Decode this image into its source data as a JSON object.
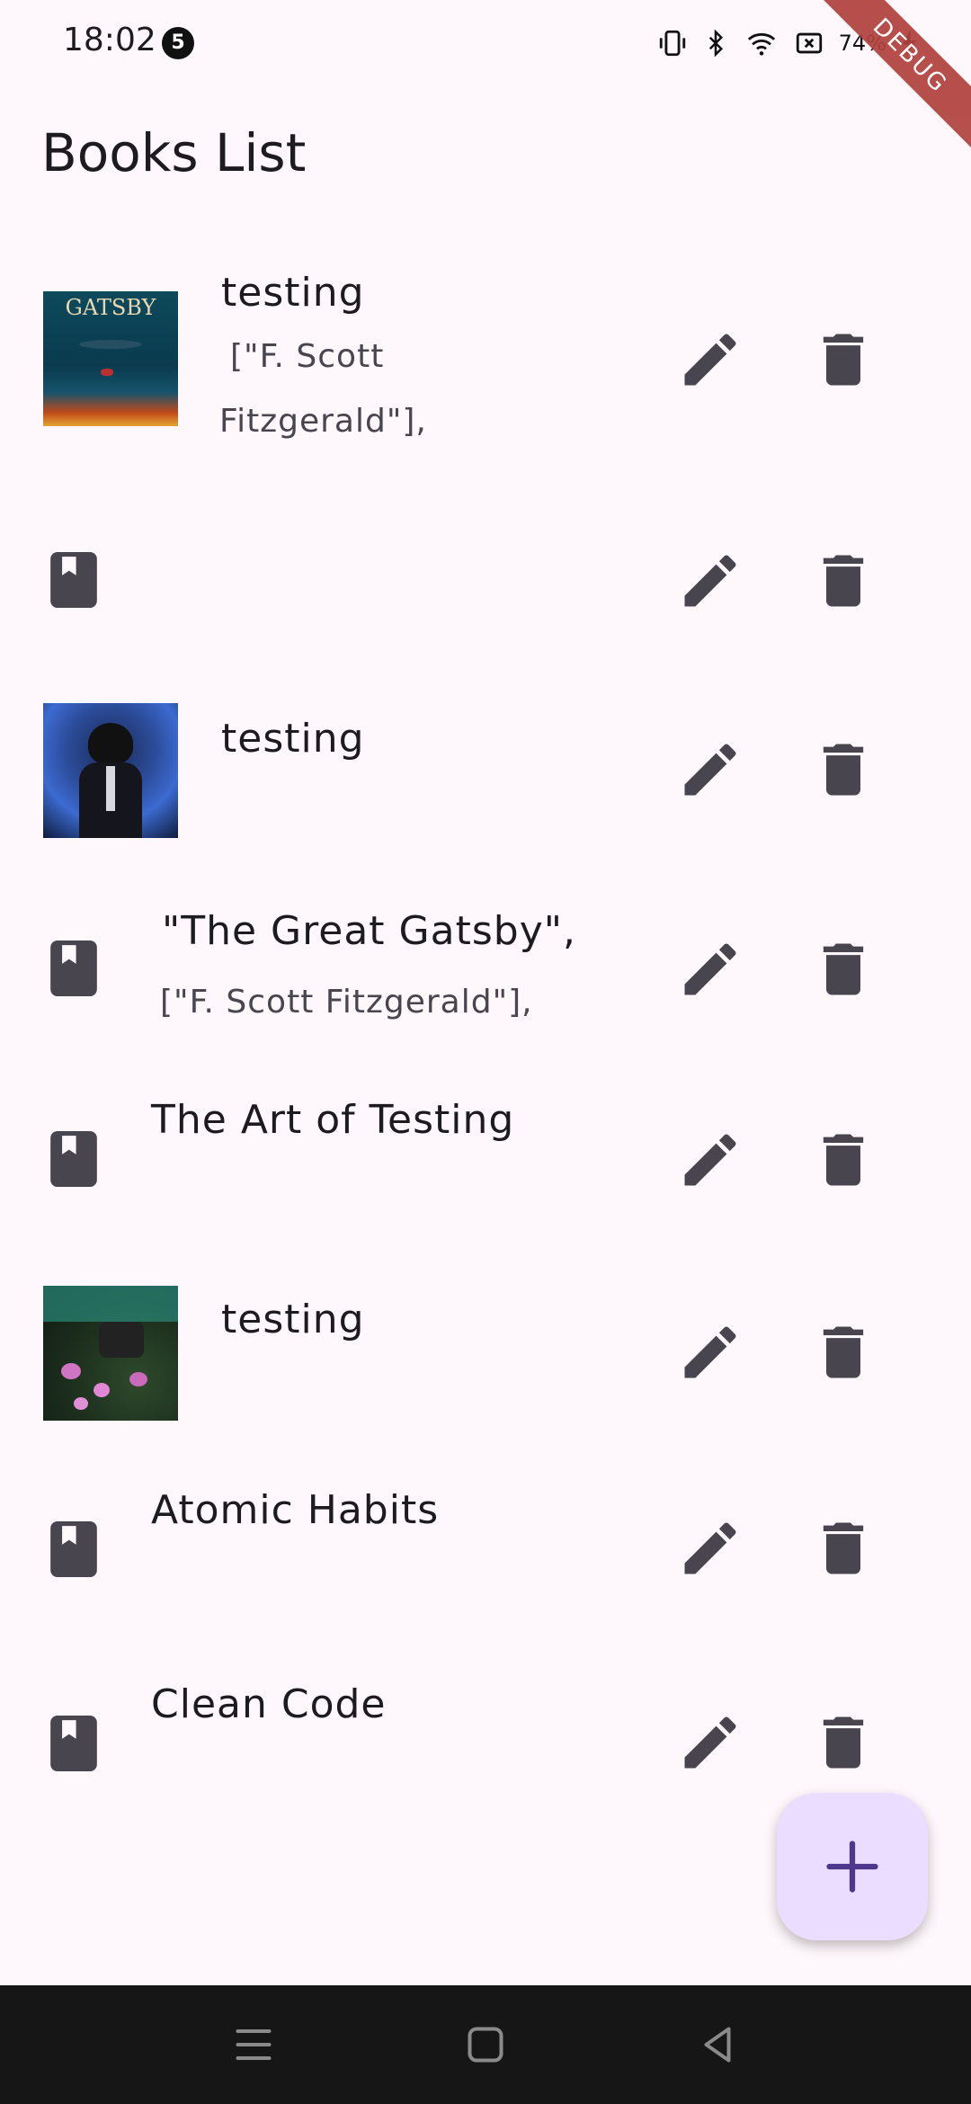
{
  "status_bar": {
    "time": "18:02",
    "notification_count": "5",
    "battery": "74%",
    "icons": [
      "vibrate-icon",
      "bluetooth-icon",
      "wifi-icon",
      "no-sim-icon",
      "charging-icon"
    ]
  },
  "debug_banner": "DEBUG",
  "app_bar": {
    "title": "Books List"
  },
  "books": [
    {
      "title": "testing",
      "author_line1": "[\"F.  Scott",
      "author_line2": "Fitzgerald\"],",
      "cover": "gatsby-cover-image",
      "cover_text": "GATSBY"
    },
    {
      "title": "",
      "cover": "book-icon"
    },
    {
      "title": "testing",
      "cover": "anime-character-cover-image"
    },
    {
      "title": "\"The Great Gatsby\",",
      "author_line1": "[\"F.  Scott Fitzgerald\"],",
      "cover": "book-icon"
    },
    {
      "title": "The Art of Testing",
      "cover": "book-icon"
    },
    {
      "title": "testing",
      "cover": "camera-flowers-cover-image"
    },
    {
      "title": "Atomic Habits",
      "cover": "book-icon"
    },
    {
      "title": "Clean Code",
      "cover": "book-icon"
    }
  ],
  "fab": {
    "icon": "add-icon"
  },
  "nav": {
    "icons": [
      "recent-apps-icon",
      "home-icon",
      "back-icon"
    ]
  },
  "colors": {
    "background": "#fef7fb",
    "fab": "#eaddff",
    "icon": "#49454f",
    "accent": "#4f378b"
  }
}
